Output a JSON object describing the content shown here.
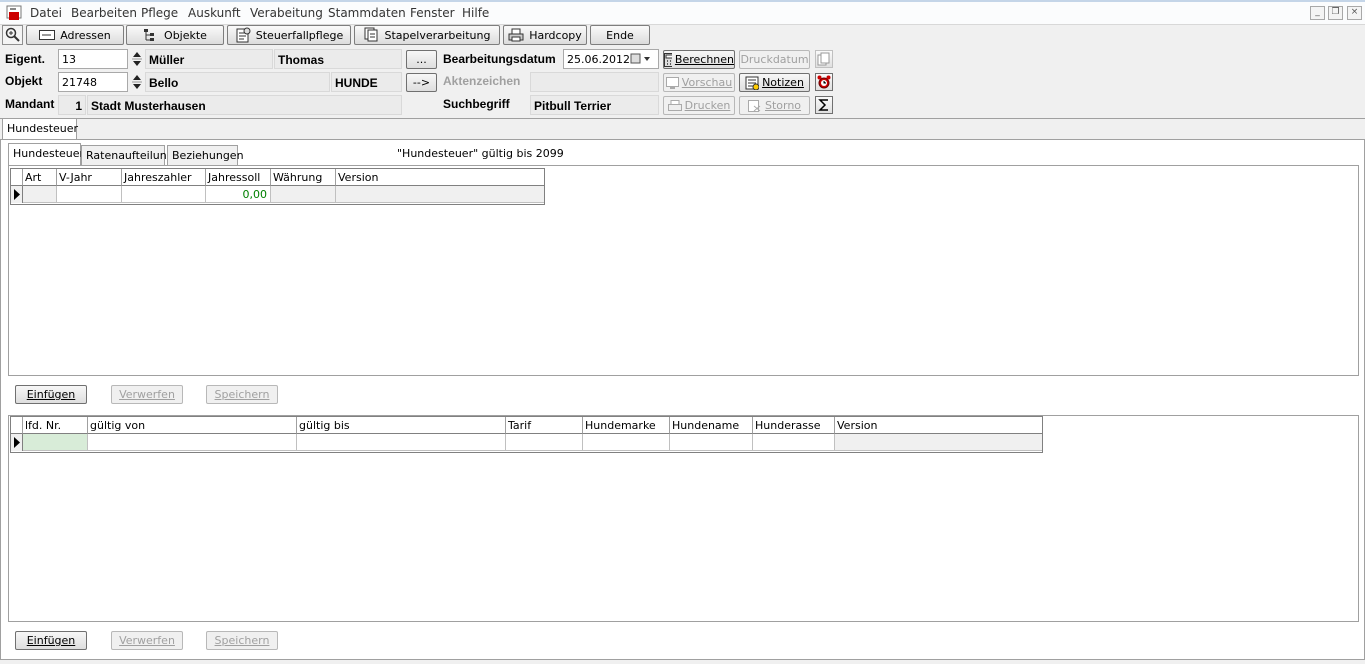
{
  "menubar": {
    "items": [
      "Datei",
      "Bearbeiten",
      "Pflege",
      "Auskunft",
      "Verabeitung",
      "Stammdaten",
      "Fenster",
      "Hilfe"
    ]
  },
  "toolbar": {
    "adressen": "Adressen",
    "objekte": "Objekte",
    "steuerfallpflege": "Steuerfallpflege",
    "stapelverarbeitung": "Stapelverarbeitung",
    "hardcopy": "Hardcopy",
    "ende": "Ende"
  },
  "header": {
    "eigent_label": "Eigent.",
    "eigent_value": "13",
    "eigent_name1": "Müller",
    "eigent_name2": "Thomas",
    "objekt_label": "Objekt",
    "objekt_value": "21748",
    "objekt_name": "Bello",
    "objekt_type": "HUNDE",
    "mandant_label": "Mandant",
    "mandant_value": "1",
    "mandant_name": "Stadt Musterhausen",
    "dots_button": "...",
    "arrow_button": "-->",
    "bearbeitungsdatum_label": "Bearbeitungsdatum",
    "bearbeitungsdatum_value": "25.06.2012",
    "aktenzeichen_label": "Aktenzeichen",
    "aktenzeichen_value": "",
    "suchbegriff_label": "Suchbegriff",
    "suchbegriff_value": "Pitbull Terrier"
  },
  "actions": {
    "berechnen": "Berechnen",
    "druckdatum": "Druckdatum",
    "vorschau": "Vorschau",
    "notizen": "Notizen",
    "drucken": "Drucken",
    "storno": "Storno"
  },
  "outer_tab": "Hundesteuer",
  "inner_tabs": [
    "Hundesteuer",
    "Ratenaufteilung",
    "Beziehungen"
  ],
  "validity_text": "\"Hundesteuer\" gültig bis 2099",
  "grid1": {
    "columns": [
      "Art",
      "V-Jahr",
      "Jahreszahler",
      "Jahressoll",
      "Währung",
      "Version"
    ],
    "row": [
      "",
      "",
      "",
      "0,00",
      "",
      ""
    ]
  },
  "grid2": {
    "columns": [
      "lfd. Nr.",
      "gültig von",
      "gültig bis",
      "Tarif",
      "Hundemarke",
      "Hundename",
      "Hunderasse",
      "Version"
    ],
    "row": [
      "",
      "",
      "",
      "",
      "",
      "",
      "",
      ""
    ]
  },
  "buttons": {
    "einfuegen": "Einfügen",
    "verwerfen": "Verwerfen",
    "speichern": "Speichern"
  },
  "colors": {
    "value_green": "#008000",
    "selected_cell": "#d8ecd8"
  }
}
